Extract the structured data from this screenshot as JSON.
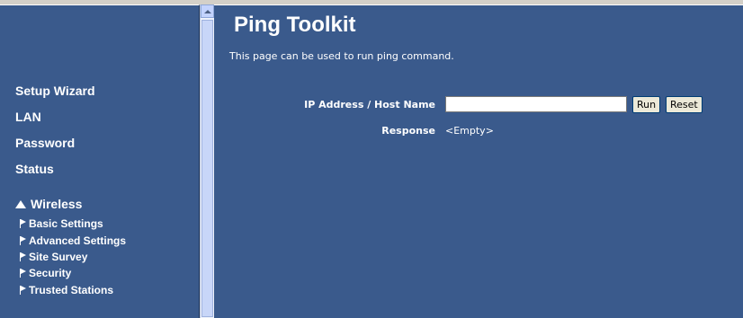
{
  "nav": {
    "main_items": [
      {
        "label": "Setup Wizard"
      },
      {
        "label": "LAN"
      },
      {
        "label": "Password"
      },
      {
        "label": "Status"
      }
    ],
    "wireless": {
      "label": "Wireless",
      "sub_items": [
        {
          "label": "Basic Settings"
        },
        {
          "label": "Advanced Settings"
        },
        {
          "label": "Site Survey"
        },
        {
          "label": "Security"
        },
        {
          "label": "Trusted Stations"
        }
      ]
    }
  },
  "page": {
    "title": "Ping Toolkit",
    "description": "This page can be used to run ping command."
  },
  "form": {
    "ip_label": "IP Address / Host Name",
    "ip_value": "",
    "run_label": "Run",
    "reset_label": "Reset",
    "response_label": "Response",
    "response_value": "<Empty>"
  },
  "colors": {
    "background": "#3a5a8c",
    "text": "#ffffff"
  }
}
